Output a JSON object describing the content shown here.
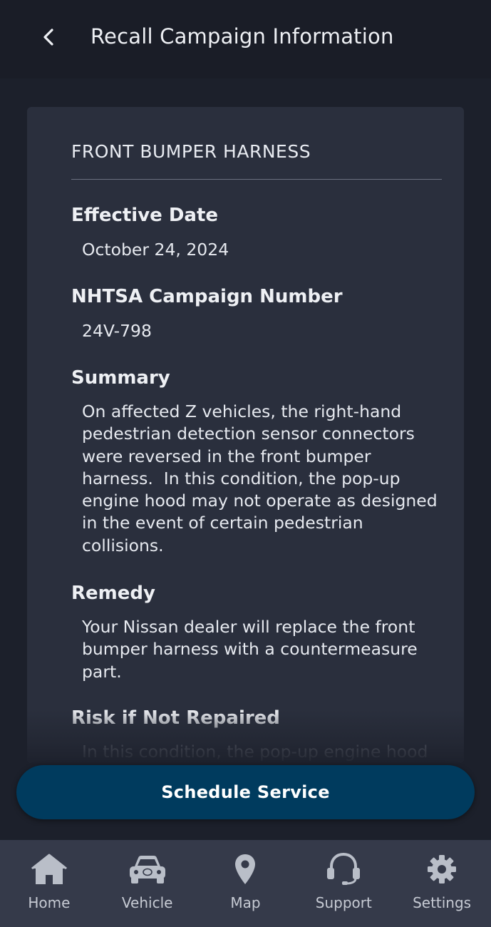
{
  "header": {
    "title": "Recall Campaign Information"
  },
  "recall": {
    "title": "FRONT BUMPER HARNESS",
    "effective_date_label": "Effective Date",
    "effective_date": "October 24, 2024",
    "campaign_label": "NHTSA Campaign Number",
    "campaign_number": "24V-798",
    "summary_label": "Summary",
    "summary_lines": [
      "On affected Z vehicles, the right-hand",
      "pedestrian detection sensor connectors",
      "were reversed in the front bumper",
      "harness.  In this condition, the pop-up",
      "engine hood may not operate as designed",
      "in the event of certain pedestrian",
      "collisions."
    ],
    "remedy_label": "Remedy",
    "remedy_lines": [
      "Your Nissan dealer will replace the front",
      "bumper harness with a countermeasure",
      "part."
    ],
    "risk_label": "Risk if Not Repaired",
    "risk_line": "In this condition, the pop-up engine hood"
  },
  "actions": {
    "schedule_label": "Schedule Service"
  },
  "nav": {
    "items": [
      {
        "label": "Home",
        "icon": "home-icon"
      },
      {
        "label": "Vehicle",
        "icon": "car-icon"
      },
      {
        "label": "Map",
        "icon": "map-pin-icon"
      },
      {
        "label": "Support",
        "icon": "headset-icon"
      },
      {
        "label": "Settings",
        "icon": "gear-icon"
      }
    ]
  },
  "colors": {
    "background": "#1c202b",
    "card": "#2a2f3d",
    "button": "#003b5e",
    "nav": "#353a4a"
  }
}
